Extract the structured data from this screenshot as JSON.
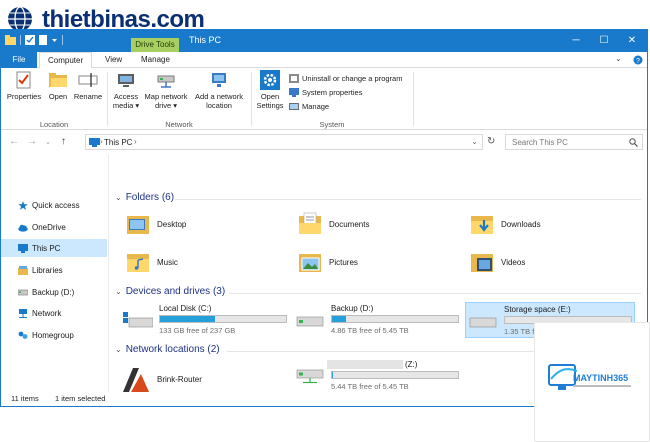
{
  "watermark": {
    "site": "thietbinas.com"
  },
  "window": {
    "title": "This PC",
    "contextual_tab": "Drive Tools",
    "controls": {
      "minimize": "─",
      "maximize": "☐",
      "close": "✕"
    }
  },
  "ribbon_tabs": {
    "file": "File",
    "computer": "Computer",
    "view": "View",
    "manage": "Manage"
  },
  "ribbon": {
    "location": {
      "label": "Location",
      "properties": "Properties",
      "open": "Open",
      "rename": "Rename"
    },
    "network": {
      "label": "Network",
      "access_media": "Access media ▾",
      "map_network_drive": "Map network drive ▾",
      "add_network_location": "Add a network location"
    },
    "system": {
      "label": "System",
      "open_settings": "Open Settings",
      "uninstall": "Uninstall or change a program",
      "system_properties": "System properties",
      "manage": "Manage"
    }
  },
  "address": {
    "path": "This PC",
    "search_placeholder": "Search This PC"
  },
  "nav": {
    "items": [
      {
        "label": "Quick access",
        "selected": false
      },
      {
        "label": "OneDrive",
        "selected": false
      },
      {
        "label": "This PC",
        "selected": true
      },
      {
        "label": "Libraries",
        "selected": false
      },
      {
        "label": "Backup (D:)",
        "selected": false
      },
      {
        "label": "Network",
        "selected": false
      },
      {
        "label": "Homegroup",
        "selected": false
      }
    ]
  },
  "sections": {
    "folders": "Folders (6)",
    "devices": "Devices and drives (3)",
    "network": "Network locations (2)"
  },
  "folders": [
    "Desktop",
    "Documents",
    "Downloads",
    "Music",
    "Pictures",
    "Videos"
  ],
  "drives": [
    {
      "name": "Local Disk (C:)",
      "free": "133 GB free of 237 GB",
      "used_fraction": 0.44,
      "selected": false
    },
    {
      "name": "Backup (D:)",
      "free": "4.86 TB free of 5.45 TB",
      "used_fraction": 0.11,
      "selected": false
    },
    {
      "name": "Storage space (E:)",
      "free": "1.35 TB free of 1.35 TB",
      "used_fraction": 0.0,
      "selected": true
    }
  ],
  "network_locations": [
    {
      "name": "Brink-Router"
    },
    {
      "name": "(Z:)",
      "free": "5.44 TB free of 5.45 TB",
      "used_fraction": 0.002
    }
  ],
  "status": {
    "items": "11 items",
    "selected": "1 item selected"
  },
  "card": {
    "brand": "MAYTINH365"
  },
  "colors": {
    "accent": "#1979ca",
    "drive_tools": "#a9cf62",
    "selection": "#cce8ff",
    "bar_fill": "#26a0da"
  }
}
